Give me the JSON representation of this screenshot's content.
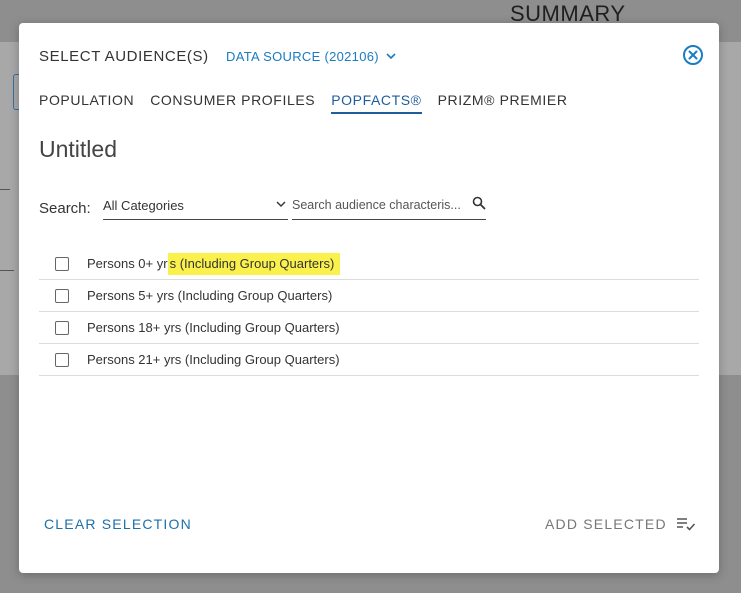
{
  "background": {
    "summary_heading": "SUMMARY"
  },
  "modal": {
    "title": "SELECT AUDIENCE(S)",
    "data_source_label": "DATA SOURCE (202106)",
    "tabs": [
      {
        "label": "POPULATION",
        "active": false
      },
      {
        "label": "CONSUMER PROFILES",
        "active": false
      },
      {
        "label": "POPFACTS®",
        "active": true
      },
      {
        "label": "PRIZM® PREMIER",
        "active": false
      }
    ],
    "audience_title": "Untitled",
    "search": {
      "label": "Search:",
      "category_value": "All Categories",
      "placeholder": "Search audience characteris..."
    },
    "items": [
      {
        "prefix": "Persons 0+ yr",
        "highlight": "s (Including Group Quarters)",
        "checked": false
      },
      {
        "label": "Persons 5+ yrs (Including Group Quarters)",
        "checked": false
      },
      {
        "label": "Persons 18+ yrs (Including Group Quarters)",
        "checked": false
      },
      {
        "label": "Persons 21+ yrs (Including Group Quarters)",
        "checked": false
      }
    ],
    "footer": {
      "clear_label": "CLEAR SELECTION",
      "add_label": "ADD SELECTED"
    },
    "colors": {
      "accent": "#1a7cc1",
      "active_tab": "#1f5d9b",
      "highlight": "#fbf14d"
    }
  }
}
